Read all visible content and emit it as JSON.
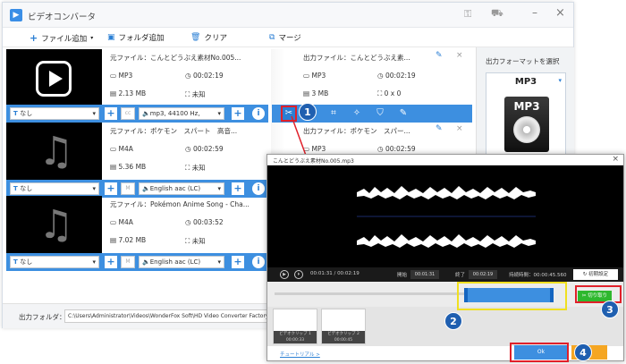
{
  "app": {
    "title": "ビデオコンバータ"
  },
  "toolbar": {
    "add_file": "ファイル追加",
    "add_folder": "フォルダ追加",
    "clear": "クリア",
    "merge": "マージ"
  },
  "files": [
    {
      "src_name": "元ファイル：こんとどうぶえ素材No.005...",
      "src_format": "MP3",
      "src_duration": "00:02:19",
      "src_size": "2.13 MB",
      "src_res": "未知",
      "out_name": "出力ファイル：こんとどうぶえ素...",
      "out_format": "MP3",
      "out_duration": "00:02:19",
      "out_size": "3 MB",
      "out_res": "0 x 0",
      "subtitle": "なし",
      "audio": "mp3, 44100 Hz,"
    },
    {
      "src_name": "元ファイル：ポケモン　スパート　高音...",
      "src_format": "M4A",
      "src_duration": "00:02:59",
      "src_size": "5.36 MB",
      "src_res": "未知",
      "out_name": "出力ファイル：ポケモン　スパー...",
      "out_format": "MP3",
      "out_duration": "00:02:59",
      "subtitle": "なし",
      "audio": "English aac (LC)"
    },
    {
      "src_name": "元ファイル：Pokémon Anime Song - Cha...",
      "src_format": "M4A",
      "src_duration": "00:03:52",
      "src_size": "7.02 MB",
      "src_res": "未知",
      "subtitle": "なし",
      "audio": "English aac (LC)"
    }
  ],
  "format_panel": {
    "title": "出力フォーマットを選択",
    "format": "MP3",
    "icon_label": "MP3"
  },
  "output": {
    "label": "出力フォルダ：",
    "path": "C:\\Users\\Administrator\\Videos\\WonderFox Soft\\HD Video Converter Factory Pro\\Ou"
  },
  "editor": {
    "title": "こんとどうぶえ素材No.005.mp3",
    "time_current": "00:01:31",
    "time_total": "00:02:19",
    "start_label": "開始",
    "start_value": "00:01:31",
    "end_label": "終了",
    "end_value": "00:02:19",
    "duration_label": "持続時間：",
    "duration_value": "00:00:45.560",
    "reset_label": "初期設定",
    "cut_label": "切り取り",
    "clips": [
      {
        "label": "ビデオクリップ 1",
        "time": "00:00:33"
      },
      {
        "label": "ビデオクリップ 2",
        "time": "00:00:45"
      }
    ],
    "tutorial": "チュートリアル >",
    "ok_label": "Ok"
  },
  "badges": [
    "1",
    "2",
    "3",
    "4"
  ],
  "colors": {
    "accent": "#3d8fe0",
    "red_highlight": "#e0202a",
    "yellow_highlight": "#f0e020",
    "cut_green": "#2eb82e"
  }
}
